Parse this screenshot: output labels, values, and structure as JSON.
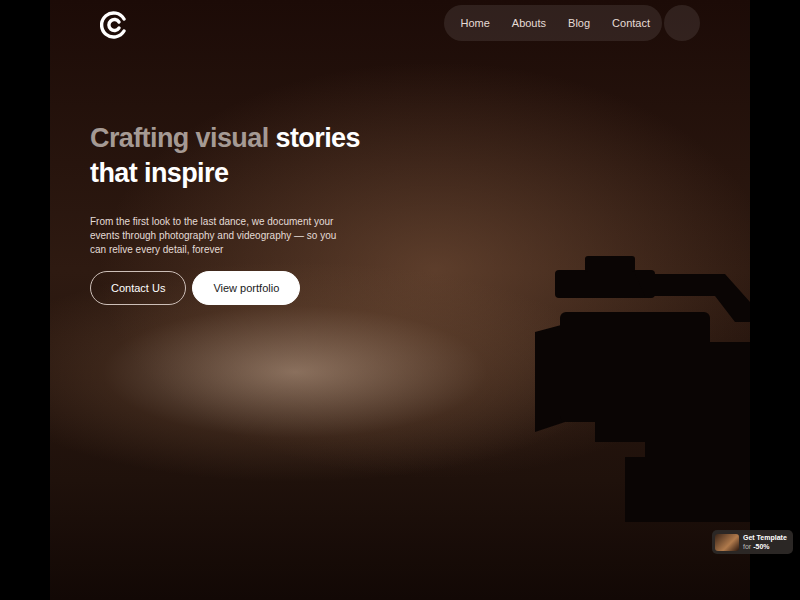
{
  "nav": {
    "items": [
      {
        "label": "Home"
      },
      {
        "label": "Abouts"
      },
      {
        "label": "Blog"
      },
      {
        "label": "Contact"
      }
    ]
  },
  "hero": {
    "headline": [
      {
        "text": "Crafting visual",
        "muted": true
      },
      {
        "text": "stories",
        "muted": false
      },
      {
        "text": "that inspire",
        "muted": false
      }
    ],
    "description": "From the first look to the last dance, we document your events through photography and videography — so you can relive every detail, forever",
    "buttons": [
      {
        "label": "Contact Us",
        "kind": "outline"
      },
      {
        "label": "View portfolio",
        "kind": "solid"
      }
    ]
  },
  "badge": {
    "title": "Get Template",
    "prefix": "for",
    "discount": "-50%"
  }
}
